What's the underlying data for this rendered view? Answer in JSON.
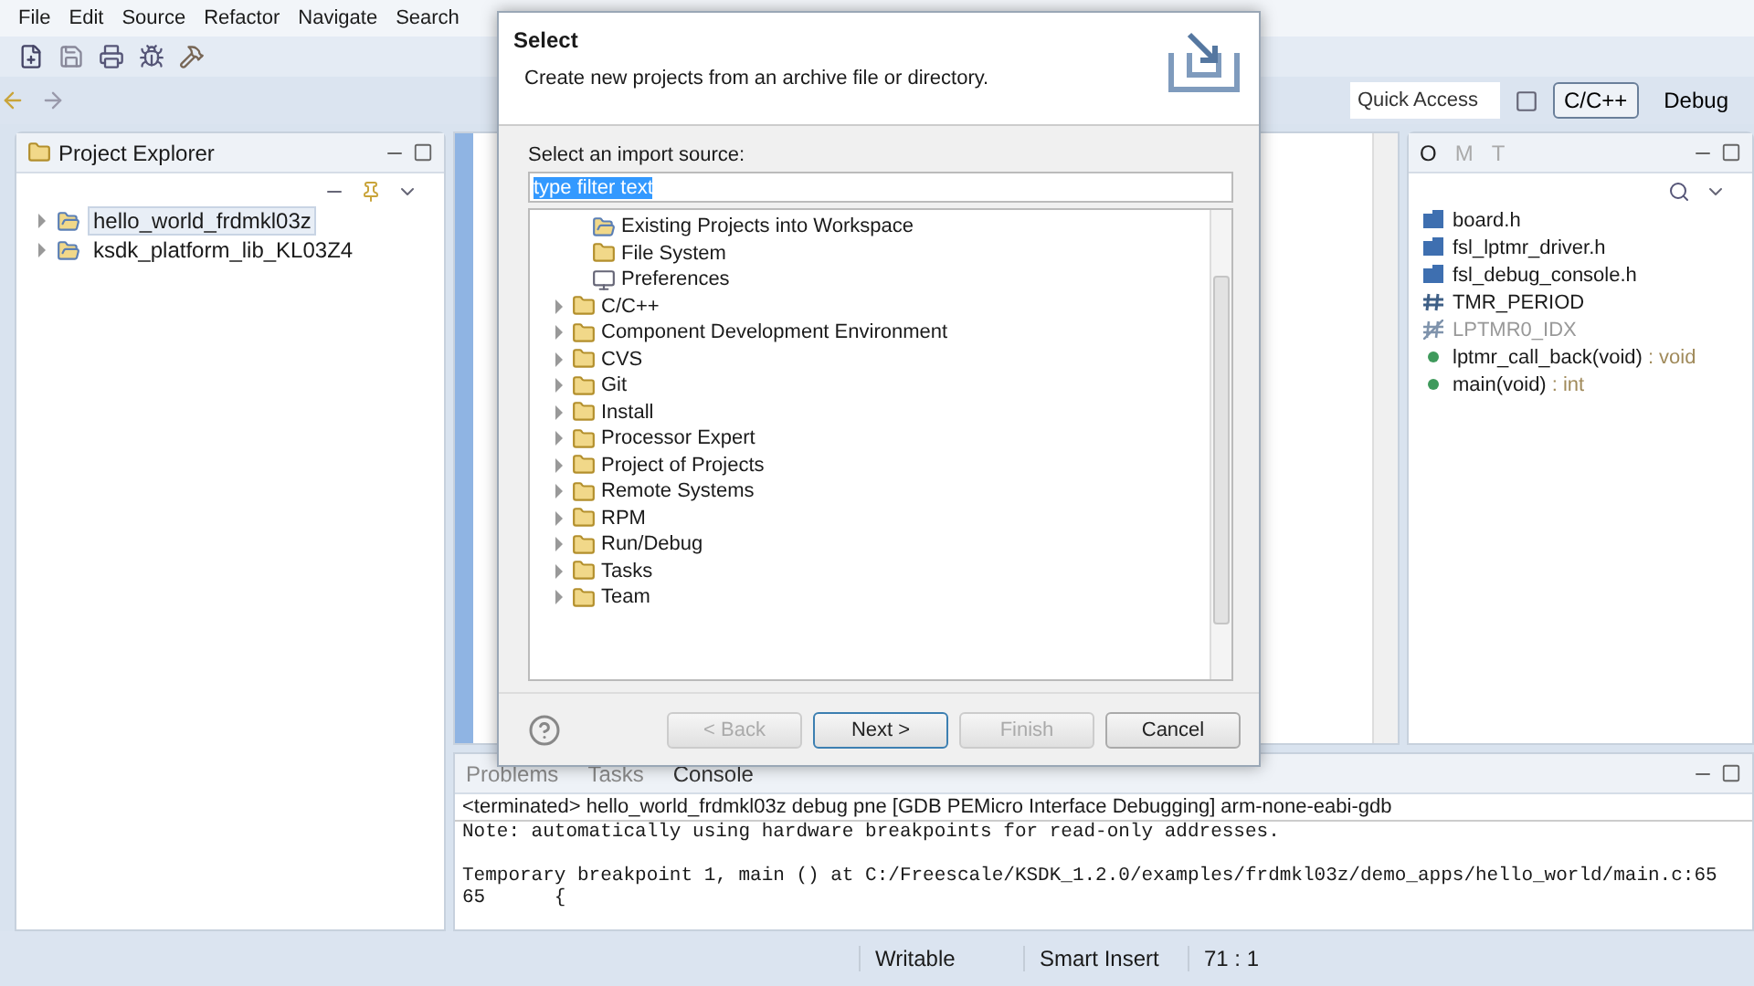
{
  "menu": [
    "File",
    "Edit",
    "Source",
    "Refactor",
    "Navigate",
    "Search"
  ],
  "toolbar": {
    "quick_access": {
      "placeholder": "Quick Access"
    },
    "perspectives": [
      {
        "label": "C/C++",
        "selected": true
      },
      {
        "label": "Debug",
        "selected": false
      }
    ]
  },
  "project_explorer": {
    "title": "Project Explorer",
    "projects": [
      {
        "label": "hello_world_frdmkl03z",
        "selected": true,
        "expanded": false
      },
      {
        "label": "ksdk_platform_lib_KL03Z4",
        "selected": false,
        "expanded": false
      }
    ]
  },
  "outline": {
    "tabs": [
      {
        "label": "O",
        "selected": true
      },
      {
        "label": "M",
        "selected": false
      },
      {
        "label": "T",
        "selected": false
      }
    ],
    "items": [
      {
        "kind": "include",
        "label": "board.h"
      },
      {
        "kind": "include",
        "label": "fsl_lptmr_driver.h"
      },
      {
        "kind": "include",
        "label": "fsl_debug_console.h"
      },
      {
        "kind": "define",
        "label": "TMR_PERIOD"
      },
      {
        "kind": "inactive_define",
        "label": "LPTMR0_IDX"
      },
      {
        "kind": "function",
        "label": "lptmr_call_back(void)",
        "type": ": void"
      },
      {
        "kind": "function",
        "label": "main(void)",
        "type": ": int"
      }
    ]
  },
  "console": {
    "tabs": [
      {
        "label": "Problems",
        "selected": false
      },
      {
        "label": "Tasks",
        "selected": false
      },
      {
        "label": "Console",
        "selected": true
      }
    ],
    "header": "<terminated> hello_world_frdmkl03z debug pne [GDB PEMicro Interface Debugging] arm-none-eabi-gdb",
    "blocks": [
      [
        "Note: automatically using hardware breakpoints for read-only addresses."
      ],
      [
        "Temporary breakpoint 1, main () at C:/Freescale/KSDK_1.2.0/examples/frdmkl03z/demo_apps/hello_world/main.c:65",
        "65      {"
      ]
    ]
  },
  "status_bar": [
    "Writable",
    "Smart Insert",
    "71 : 1"
  ],
  "dialog": {
    "title": "Select",
    "description": "Create new projects from an archive file or directory.",
    "source_label": "Select an import source:",
    "filter": {
      "value": "type filter text",
      "selected": true
    },
    "tree": {
      "open_group_children": [
        {
          "kind": "projects",
          "label": "Existing Projects into Workspace"
        },
        {
          "kind": "file_system",
          "label": "File System"
        },
        {
          "kind": "preferences",
          "label": "Preferences"
        }
      ],
      "folders": [
        {
          "label": "C/C++",
          "expanded": false
        },
        {
          "label": "Component Development Environment",
          "expanded": false
        },
        {
          "label": "CVS",
          "expanded": false
        },
        {
          "label": "Git",
          "expanded": false
        },
        {
          "label": "Install",
          "expanded": false
        },
        {
          "label": "Processor Expert",
          "expanded": false
        },
        {
          "label": "Project of Projects",
          "expanded": false
        },
        {
          "label": "Remote Systems",
          "expanded": false
        },
        {
          "label": "RPM",
          "expanded": false
        },
        {
          "label": "Run/Debug",
          "expanded": false
        },
        {
          "label": "Tasks",
          "expanded": false
        },
        {
          "label": "Team",
          "expanded": false
        }
      ]
    },
    "buttons": [
      {
        "label": "< Back",
        "disabled": true,
        "default": false
      },
      {
        "label": "Next >",
        "disabled": false,
        "default": true
      },
      {
        "label": "Finish",
        "disabled": true,
        "default": false
      },
      {
        "label": "Cancel",
        "disabled": false,
        "default": false
      }
    ]
  }
}
